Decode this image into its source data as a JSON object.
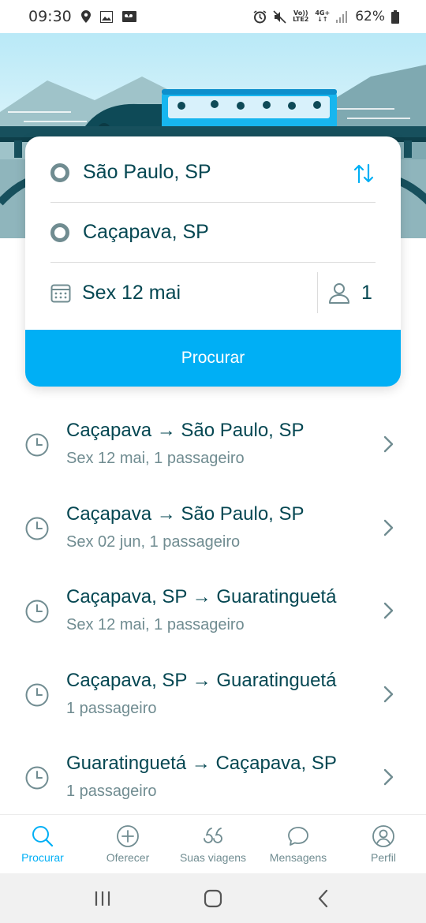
{
  "status_bar": {
    "time": "09:30",
    "battery": "62%",
    "net_top": "Vo))",
    "net_bottom": "LTE2",
    "gen_top": "4G+",
    "gen_bottom": "↓↑"
  },
  "search": {
    "origin": "São Paulo, SP",
    "destination": "Caçapava, SP",
    "date": "Sex 12 mai",
    "passengers": "1",
    "button_label": "Procurar"
  },
  "history": [
    {
      "route": "Caçapava → São Paulo, SP",
      "details": "Sex 12 mai, 1 passageiro"
    },
    {
      "route": "Caçapava → São Paulo, SP",
      "details": "Sex 02 jun, 1 passageiro"
    },
    {
      "route": "Caçapava, SP → Guaratinguetá",
      "details": "Sex 12 mai, 1 passageiro"
    },
    {
      "route": "Caçapava, SP → Guaratinguetá",
      "details": "1 passageiro"
    },
    {
      "route": "Guaratinguetá → Caçapava, SP",
      "details": "1 passageiro"
    }
  ],
  "bottom_nav": [
    {
      "label": "Procurar",
      "icon": "search-icon",
      "active": true
    },
    {
      "label": "Oferecer",
      "icon": "plus-circle-icon",
      "active": false
    },
    {
      "label": "Suas viagens",
      "icon": "quote-icon",
      "active": false
    },
    {
      "label": "Mensagens",
      "icon": "chat-bubble-icon",
      "active": false
    },
    {
      "label": "Perfil",
      "icon": "profile-icon",
      "active": false
    }
  ],
  "colors": {
    "accent": "#00aff5",
    "text_primary": "#054752",
    "text_secondary": "#708c91"
  }
}
